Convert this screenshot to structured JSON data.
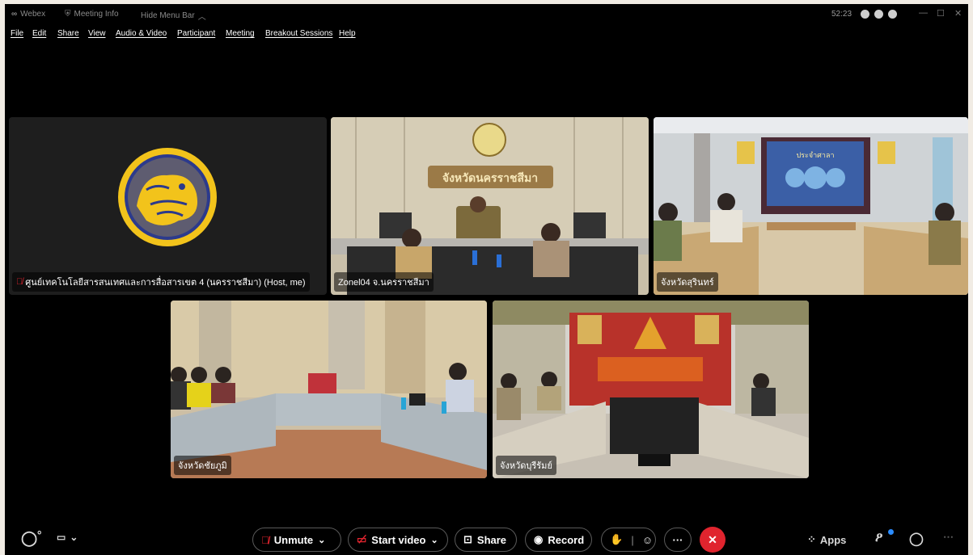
{
  "titlebar": {
    "app_name": "Webex",
    "meeting_info": "Meeting Info",
    "hide_menu": "Hide Menu Bar",
    "time": "52:23"
  },
  "menu": [
    "File",
    "Edit",
    "Share",
    "View",
    "Audio & Video",
    "Participant",
    "Meeting",
    "Breakout Sessions",
    "Help"
  ],
  "tiles": [
    {
      "name": "ศูนย์เทคโนโลยีสารสนเทศและการสื่อสารเขต 4 (นครราชสีมา) (Host, me)",
      "muted": true
    },
    {
      "name": "Zonel04 จ.นครราชสีมา",
      "muted": false,
      "banner": "จังหวัดนครราชสีมา"
    },
    {
      "name": "จังหวัดสุรินทร์",
      "muted": false,
      "banner": "ประจำศาลา"
    },
    {
      "name": "จังหวัดชัยภูมิ",
      "muted": false
    },
    {
      "name": "จังหวัดบุรีรัมย์",
      "muted": false
    }
  ],
  "controls": {
    "unmute": "Unmute",
    "start_video": "Start video",
    "share": "Share",
    "record": "Record",
    "more": "···",
    "apps": "Apps"
  },
  "colors": {
    "background": "#000000",
    "end_call": "#e0242e",
    "mute_icon": "#e0242e",
    "seal_gold": "#f2c31b",
    "seal_blue": "#2c3a8c"
  }
}
